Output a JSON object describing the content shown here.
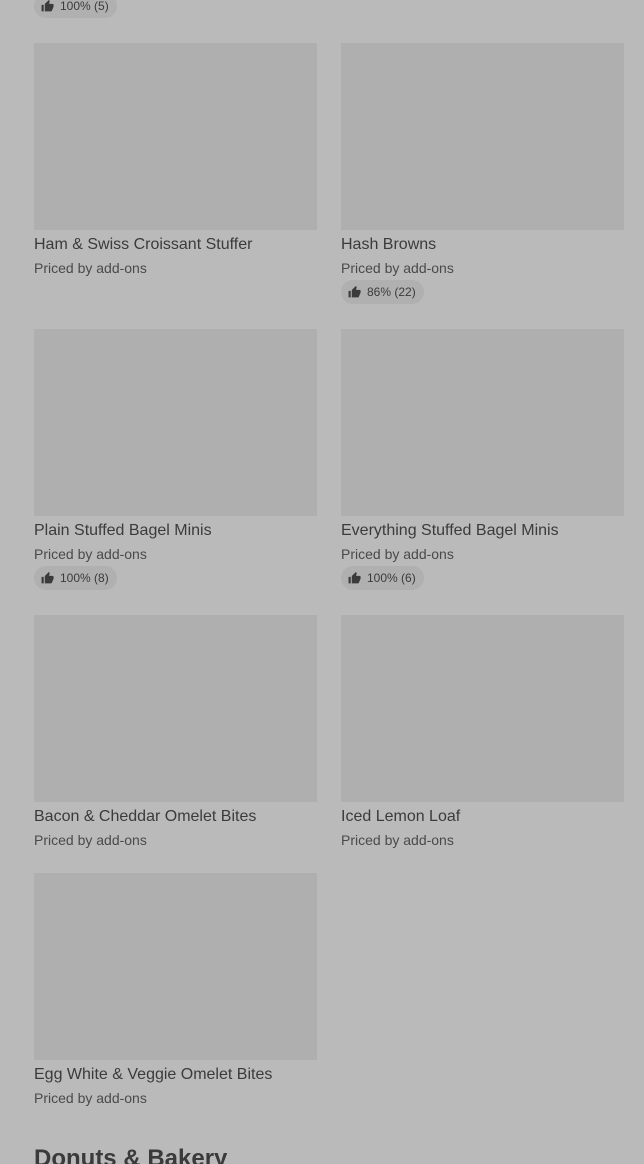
{
  "top_rating": {
    "label": "100% (5)"
  },
  "items": [
    {
      "name": "Ham & Swiss Croissant Stuffer",
      "price": "Priced by add-ons",
      "rating": ""
    },
    {
      "name": "Hash Browns",
      "price": "Priced by add-ons",
      "rating": "86% (22)"
    },
    {
      "name": "Plain Stuffed Bagel Minis",
      "price": "Priced by add-ons",
      "rating": "100% (8)"
    },
    {
      "name": "Everything Stuffed Bagel Minis",
      "price": "Priced by add-ons",
      "rating": "100% (6)"
    },
    {
      "name": "Bacon & Cheddar Omelet Bites",
      "price": "Priced by add-ons",
      "rating": ""
    },
    {
      "name": "Iced Lemon Loaf",
      "price": "Priced by add-ons",
      "rating": ""
    },
    {
      "name": "Egg White & Veggie Omelet Bites",
      "price": "Priced by add-ons",
      "rating": ""
    }
  ],
  "next_section": {
    "title": "Donuts & Bakery"
  },
  "icons": {
    "rating": "thumbs-up-icon"
  }
}
